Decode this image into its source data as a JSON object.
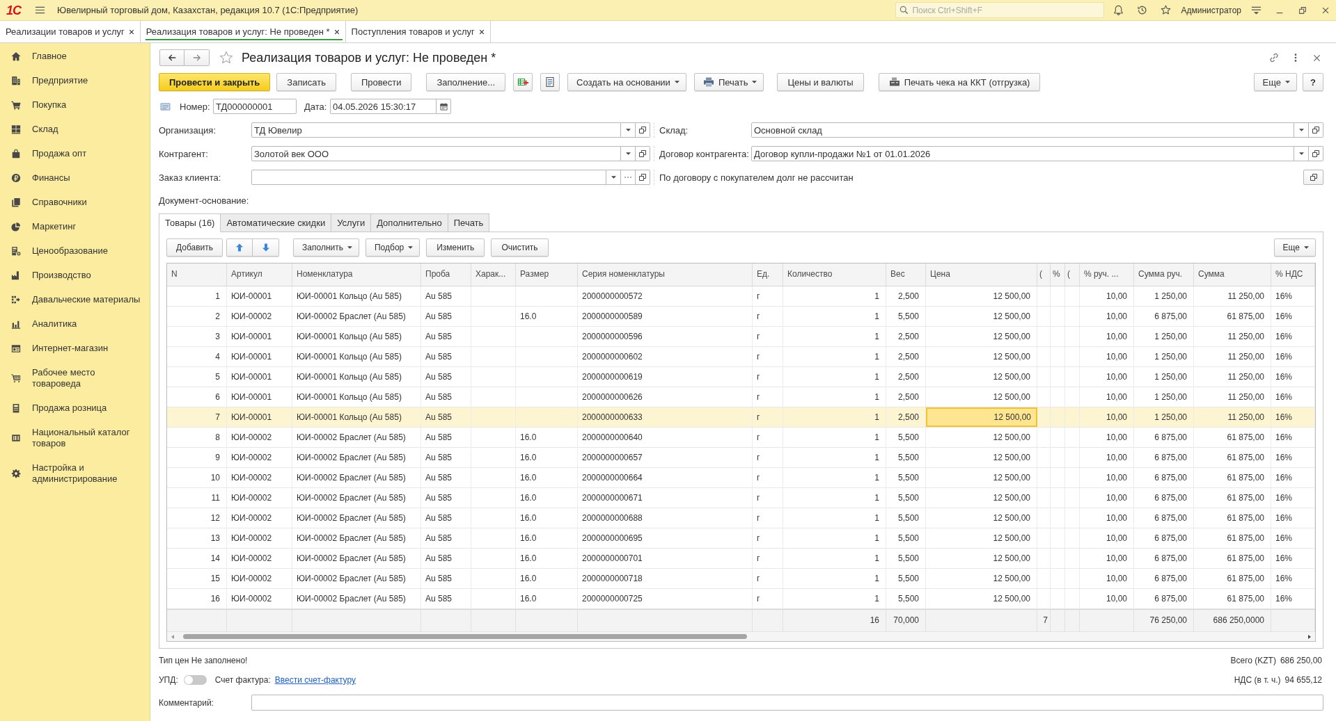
{
  "app_bar": {
    "logo": "1С",
    "title": "Ювелирный торговый дом, Казахстан, редакция 10.7 (1С:Предприятие)",
    "search": {
      "placeholder": "Поиск Ctrl+Shift+F"
    },
    "user": "Администратор"
  },
  "window_tabs": [
    {
      "label": "Реализации товаров и услуг",
      "selected": false
    },
    {
      "label": "Реализация товаров и услуг: Не проведен *",
      "selected": true
    },
    {
      "label": "Поступления товаров и услуг",
      "selected": false
    }
  ],
  "sidebar": {
    "items": [
      "Главное",
      "Предприятие",
      "Покупка",
      "Склад",
      "Продажа опт",
      "Финансы",
      "Справочники",
      "Маркетинг",
      "Ценообразование",
      "Производство",
      "Давальческие материалы",
      "Аналитика",
      "Интернет-магазин",
      "Рабочее место товароведа",
      "Продажа розница",
      "Национальный каталог товаров",
      "Настройка и администрирование"
    ]
  },
  "form": {
    "title": "Реализация товаров и услуг: Не проведен *",
    "toolbar": [
      {
        "label": "Провести и закрыть",
        "kind": "primary"
      },
      {
        "label": "Записать",
        "kind": "plain"
      },
      {
        "label": "Провести",
        "kind": "plain"
      },
      {
        "label": "Заполнение...",
        "kind": "plain"
      },
      {
        "kind": "icon"
      },
      {
        "kind": "icon"
      },
      {
        "label": "Создать на основании",
        "kind": "menu"
      },
      {
        "label": "Печать",
        "kind": "menu"
      },
      {
        "label": "Цены и валюты",
        "kind": "plain"
      },
      {
        "label": "Печать чека на ККТ (отгрузка)",
        "kind": "plain"
      }
    ],
    "toolbar_right": [
      {
        "label": "Еще",
        "kind": "menu"
      },
      {
        "label": "?",
        "kind": "plain"
      }
    ],
    "number": {
      "label": "Номер:",
      "value": "ТД000000001"
    },
    "date": {
      "label": "Дата:",
      "value": "04.05.2026 15:30:17"
    },
    "fields_left": [
      {
        "label": "Организация:",
        "value": "ТД Ювелир",
        "kind": "select"
      },
      {
        "label": "Контрагент:",
        "value": "Золотой век ООО",
        "kind": "select"
      },
      {
        "label": "Заказ клиента:",
        "kind": "select_dialog"
      }
    ],
    "fields_right": [
      {
        "label": "Склад:",
        "value": "Основной склад",
        "kind": "select"
      },
      {
        "label": "Договор контрагента:",
        "value": "Договор купли-продажи №1 от 01.01.2026",
        "kind": "select"
      }
    ],
    "debt_note": "По договору с покупателем долг не рассчитан",
    "basis_label": "Документ-основание:",
    "tabs": [
      {
        "label": "Товары (16)",
        "selected": true
      },
      {
        "label": "Автоматические скидки",
        "selected": false
      },
      {
        "label": "Услуги",
        "selected": false
      },
      {
        "label": "Дополнительно",
        "selected": false
      },
      {
        "label": "Печать",
        "selected": false
      }
    ]
  },
  "table": {
    "toolbar": [
      {
        "label": "Добавить",
        "kind": "plain"
      },
      {
        "kind": "move_up"
      },
      {
        "kind": "move_down"
      },
      {
        "label": "Заполнить",
        "kind": "menu"
      },
      {
        "label": "Подбор",
        "kind": "menu"
      },
      {
        "label": "Изменить",
        "kind": "plain"
      },
      {
        "label": "Очистить",
        "kind": "plain"
      }
    ],
    "more": {
      "label": "Еще",
      "kind": "menu"
    },
    "columns": [
      "N",
      "Артикул",
      "Номенклатура",
      "Проба",
      "Харак...",
      "Размер",
      "Серия номенклатуры",
      "Ед.",
      "Количество",
      "Вес",
      "Цена",
      "(",
      "%",
      "(",
      "% руч. ...",
      "Сумма руч.",
      "Сумма",
      "% НДС"
    ],
    "rows": [
      {
        "n": "1",
        "article": "ЮИ-00001",
        "item": "ЮИ-00001 Кольцо (Au 585)",
        "probe": "Au 585",
        "series": "2000000000572",
        "unit": "г",
        "qty": "1",
        "weight": "2,500",
        "price": "12 500,00",
        "manual_pct": "10,00",
        "manual_sum": "1 250,00",
        "sum": "11 250,00",
        "vat": "16%",
        "selected": false
      },
      {
        "n": "2",
        "article": "ЮИ-00002",
        "item": "ЮИ-00002 Браслет (Au 585)",
        "probe": "Au 585",
        "size": "16.0",
        "series": "2000000000589",
        "unit": "г",
        "qty": "1",
        "weight": "5,500",
        "price": "12 500,00",
        "manual_pct": "10,00",
        "manual_sum": "6 875,00",
        "sum": "61 875,00",
        "vat": "16%",
        "selected": false
      },
      {
        "n": "3",
        "article": "ЮИ-00001",
        "item": "ЮИ-00001 Кольцо (Au 585)",
        "probe": "Au 585",
        "series": "2000000000596",
        "unit": "г",
        "qty": "1",
        "weight": "2,500",
        "price": "12 500,00",
        "manual_pct": "10,00",
        "manual_sum": "1 250,00",
        "sum": "11 250,00",
        "vat": "16%",
        "selected": false
      },
      {
        "n": "4",
        "article": "ЮИ-00001",
        "item": "ЮИ-00001 Кольцо (Au 585)",
        "probe": "Au 585",
        "series": "2000000000602",
        "unit": "г",
        "qty": "1",
        "weight": "2,500",
        "price": "12 500,00",
        "manual_pct": "10,00",
        "manual_sum": "1 250,00",
        "sum": "11 250,00",
        "vat": "16%",
        "selected": false
      },
      {
        "n": "5",
        "article": "ЮИ-00001",
        "item": "ЮИ-00001 Кольцо (Au 585)",
        "probe": "Au 585",
        "series": "2000000000619",
        "unit": "г",
        "qty": "1",
        "weight": "2,500",
        "price": "12 500,00",
        "manual_pct": "10,00",
        "manual_sum": "1 250,00",
        "sum": "11 250,00",
        "vat": "16%",
        "selected": false
      },
      {
        "n": "6",
        "article": "ЮИ-00001",
        "item": "ЮИ-00001 Кольцо (Au 585)",
        "probe": "Au 585",
        "series": "2000000000626",
        "unit": "г",
        "qty": "1",
        "weight": "2,500",
        "price": "12 500,00",
        "manual_pct": "10,00",
        "manual_sum": "1 250,00",
        "sum": "11 250,00",
        "vat": "16%",
        "selected": false
      },
      {
        "n": "7",
        "article": "ЮИ-00001",
        "item": "ЮИ-00001 Кольцо (Au 585)",
        "probe": "Au 585",
        "series": "2000000000633",
        "unit": "г",
        "qty": "1",
        "weight": "2,500",
        "price": "12 500,00",
        "manual_pct": "10,00",
        "manual_sum": "1 250,00",
        "sum": "11 250,00",
        "vat": "16%",
        "selected": true
      },
      {
        "n": "8",
        "article": "ЮИ-00002",
        "item": "ЮИ-00002 Браслет (Au 585)",
        "probe": "Au 585",
        "size": "16.0",
        "series": "2000000000640",
        "unit": "г",
        "qty": "1",
        "weight": "5,500",
        "price": "12 500,00",
        "manual_pct": "10,00",
        "manual_sum": "6 875,00",
        "sum": "61 875,00",
        "vat": "16%",
        "selected": false
      },
      {
        "n": "9",
        "article": "ЮИ-00002",
        "item": "ЮИ-00002 Браслет (Au 585)",
        "probe": "Au 585",
        "size": "16.0",
        "series": "2000000000657",
        "unit": "г",
        "qty": "1",
        "weight": "5,500",
        "price": "12 500,00",
        "manual_pct": "10,00",
        "manual_sum": "6 875,00",
        "sum": "61 875,00",
        "vat": "16%",
        "selected": false
      },
      {
        "n": "10",
        "article": "ЮИ-00002",
        "item": "ЮИ-00002 Браслет (Au 585)",
        "probe": "Au 585",
        "size": "16.0",
        "series": "2000000000664",
        "unit": "г",
        "qty": "1",
        "weight": "5,500",
        "price": "12 500,00",
        "manual_pct": "10,00",
        "manual_sum": "6 875,00",
        "sum": "61 875,00",
        "vat": "16%",
        "selected": false
      },
      {
        "n": "11",
        "article": "ЮИ-00002",
        "item": "ЮИ-00002 Браслет (Au 585)",
        "probe": "Au 585",
        "size": "16.0",
        "series": "2000000000671",
        "unit": "г",
        "qty": "1",
        "weight": "5,500",
        "price": "12 500,00",
        "manual_pct": "10,00",
        "manual_sum": "6 875,00",
        "sum": "61 875,00",
        "vat": "16%",
        "selected": false
      },
      {
        "n": "12",
        "article": "ЮИ-00002",
        "item": "ЮИ-00002 Браслет (Au 585)",
        "probe": "Au 585",
        "size": "16.0",
        "series": "2000000000688",
        "unit": "г",
        "qty": "1",
        "weight": "5,500",
        "price": "12 500,00",
        "manual_pct": "10,00",
        "manual_sum": "6 875,00",
        "sum": "61 875,00",
        "vat": "16%",
        "selected": false
      },
      {
        "n": "13",
        "article": "ЮИ-00002",
        "item": "ЮИ-00002 Браслет (Au 585)",
        "probe": "Au 585",
        "size": "16.0",
        "series": "2000000000695",
        "unit": "г",
        "qty": "1",
        "weight": "5,500",
        "price": "12 500,00",
        "manual_pct": "10,00",
        "manual_sum": "6 875,00",
        "sum": "61 875,00",
        "vat": "16%",
        "selected": false
      },
      {
        "n": "14",
        "article": "ЮИ-00002",
        "item": "ЮИ-00002 Браслет (Au 585)",
        "probe": "Au 585",
        "size": "16.0",
        "series": "2000000000701",
        "unit": "г",
        "qty": "1",
        "weight": "5,500",
        "price": "12 500,00",
        "manual_pct": "10,00",
        "manual_sum": "6 875,00",
        "sum": "61 875,00",
        "vat": "16%",
        "selected": false
      },
      {
        "n": "15",
        "article": "ЮИ-00002",
        "item": "ЮИ-00002 Браслет (Au 585)",
        "probe": "Au 585",
        "size": "16.0",
        "series": "2000000000718",
        "unit": "г",
        "qty": "1",
        "weight": "5,500",
        "price": "12 500,00",
        "manual_pct": "10,00",
        "manual_sum": "6 875,00",
        "sum": "61 875,00",
        "vat": "16%",
        "selected": false
      },
      {
        "n": "16",
        "article": "ЮИ-00002",
        "item": "ЮИ-00002 Браслет (Au 585)",
        "probe": "Au 585",
        "size": "16.0",
        "series": "2000000000725",
        "unit": "г",
        "qty": "1",
        "weight": "5,500",
        "price": "12 500,00",
        "manual_pct": "10,00",
        "manual_sum": "6 875,00",
        "sum": "61 875,00",
        "vat": "16%",
        "selected": false
      }
    ],
    "totals": {
      "qty": "16",
      "weight": "70,000",
      "column_12": "7",
      "manual_sum": "76 250,00",
      "sum": "686 250,0000"
    }
  },
  "footer": {
    "price_type_note": "Тип цен Не заполнено!",
    "upd": {
      "label": "УПД:",
      "on": false
    },
    "invoice": {
      "label": "Счет фактура:",
      "link": "Ввести счет-фактуру"
    },
    "totals": [
      {
        "label": "Всего (KZT)",
        "value": "686 250,00"
      },
      {
        "label": "НДС (в т. ч.)",
        "value": "94 655,12"
      }
    ],
    "comment": {
      "label": "Комментарий:"
    }
  }
}
